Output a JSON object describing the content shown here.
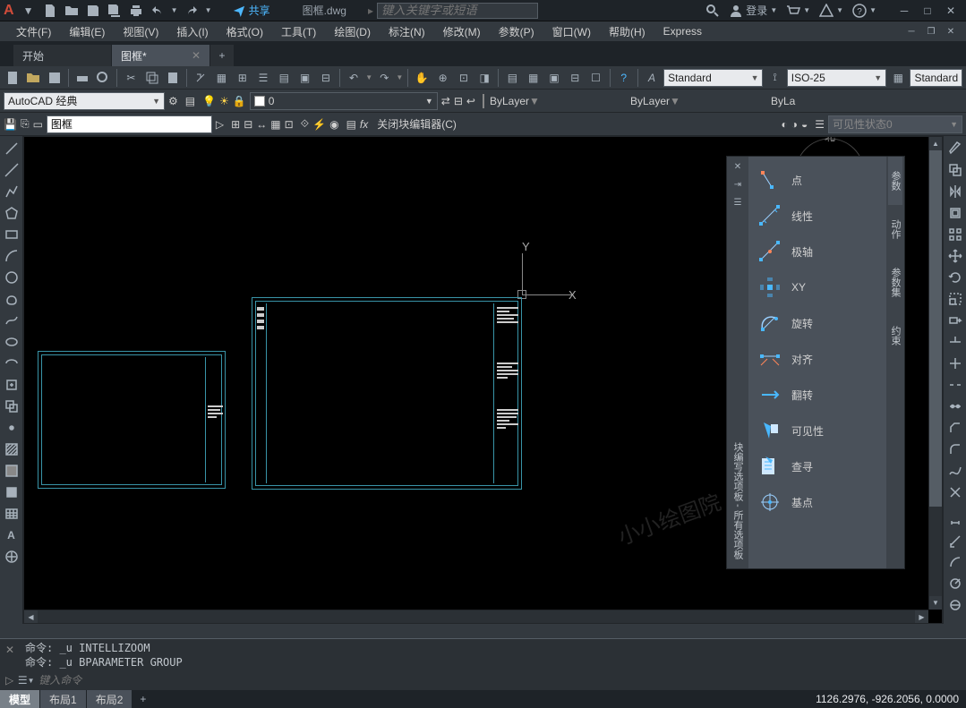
{
  "title": {
    "filename": "图框.dwg",
    "share": "共享",
    "search_placeholder": "键入关键字或短语",
    "login": "登录"
  },
  "menu": {
    "file": "文件(F)",
    "edit": "编辑(E)",
    "view": "视图(V)",
    "insert": "插入(I)",
    "format": "格式(O)",
    "tools": "工具(T)",
    "draw": "绘图(D)",
    "dimension": "标注(N)",
    "modify": "修改(M)",
    "param": "参数(P)",
    "window": "窗口(W)",
    "help": "帮助(H)",
    "express": "Express"
  },
  "tabs": {
    "t0": "开始",
    "t1": "图框*"
  },
  "toolbar2": {
    "textstyle": "Standard",
    "dimstyle": "ISO-25",
    "tablestyle": "Standard"
  },
  "workspace": {
    "name": "AutoCAD 经典",
    "layer": "0",
    "color": "ByLayer",
    "ltype": "ByLayer",
    "lweight": "ByLa"
  },
  "blockedit": {
    "blockname": "图框",
    "close": "关闭块编辑器(C)",
    "vis": "可见性状态0"
  },
  "palette": {
    "title": "块编写选项板 - 所有选项板",
    "items": {
      "point": "点",
      "linear": "线性",
      "polar": "极轴",
      "xy": "XY",
      "rotate": "旋转",
      "align": "对齐",
      "flip": "翻转",
      "vis": "可见性",
      "lookup": "查寻",
      "base": "基点"
    },
    "sidetabs": {
      "param": "参数",
      "action": "动作",
      "paramset": "参数集",
      "constraint": "约束"
    }
  },
  "north": "北",
  "ucs": {
    "x": "X",
    "y": "Y"
  },
  "cmd": {
    "hist1": "命令: _u INTELLIZOOM",
    "hist2": "命令: _u BPARAMETER GROUP",
    "prompt": "键入命令"
  },
  "status": {
    "model": "模型",
    "layout1": "布局1",
    "layout2": "布局2",
    "coords": "1126.2976, -926.2056, 0.0000"
  },
  "watermark": "小小绘图院"
}
